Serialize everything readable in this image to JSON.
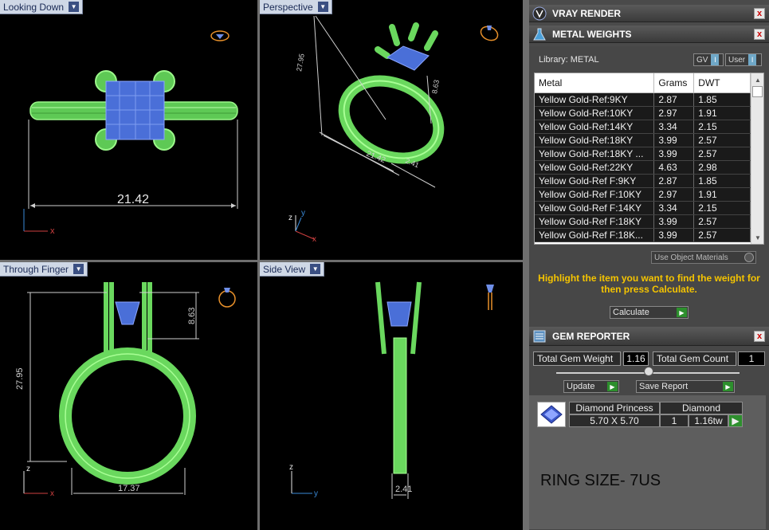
{
  "viewports": {
    "top_left": {
      "label": "Looking Down",
      "dimension": "21.42",
      "axes": [
        "x"
      ]
    },
    "top_right": {
      "label": "Perspective",
      "dimensions": [
        "27.95",
        "8.63",
        "21.42",
        "2.41"
      ],
      "axes": [
        "z",
        "y",
        "x"
      ]
    },
    "bottom_left": {
      "label": "Through Finger",
      "dimensions": [
        "27.95",
        "8.63",
        "17.37"
      ],
      "axes": [
        "z",
        "x"
      ]
    },
    "bottom_right": {
      "label": "Side View",
      "dimension": "2.41",
      "axes": [
        "z",
        "y"
      ]
    }
  },
  "panel": {
    "vray": {
      "title": "VRAY RENDER",
      "close": "x"
    },
    "metal": {
      "title": "METAL WEIGHTS",
      "close": "x",
      "library_label": "Library: METAL",
      "toggle_gv": "GV",
      "toggle_user": "User",
      "toggle_mark": "I",
      "columns": [
        "Metal",
        "Grams",
        "DWT"
      ],
      "rows": [
        [
          "Yellow Gold-Ref:9KY",
          "2.87",
          "1.85"
        ],
        [
          "Yellow Gold-Ref:10KY",
          "2.97",
          "1.91"
        ],
        [
          "Yellow Gold-Ref:14KY",
          "3.34",
          "2.15"
        ],
        [
          "Yellow Gold-Ref:18KY",
          "3.99",
          "2.57"
        ],
        [
          "Yellow Gold-Ref:18KY ...",
          "3.99",
          "2.57"
        ],
        [
          "Yellow Gold-Ref:22KY",
          "4.63",
          "2.98"
        ],
        [
          "Yellow Gold-Ref F:9KY",
          "2.87",
          "1.85"
        ],
        [
          "Yellow Gold-Ref F:10KY",
          "2.97",
          "1.91"
        ],
        [
          "Yellow Gold-Ref F:14KY",
          "3.34",
          "2.15"
        ],
        [
          "Yellow Gold-Ref F:18KY",
          "3.99",
          "2.57"
        ],
        [
          "Yellow Gold-Ref F:18K...",
          "3.99",
          "2.57"
        ]
      ],
      "use_object_materials": "Use Object Materials",
      "hint": "Highlight the item you want to find the weight for then press Calculate.",
      "calculate": "Calculate",
      "go": "▶"
    },
    "gem": {
      "title": "GEM REPORTER",
      "close": "x",
      "total_weight_label": "Total Gem Weight",
      "total_weight_value": "1.16",
      "total_count_label": "Total Gem Count",
      "total_count_value": "1",
      "update": "Update",
      "save_report": "Save Report",
      "go": "▶",
      "gem_name": "Diamond Princess",
      "gem_size": "5.70 X 5.70",
      "gem_type": "Diamond",
      "gem_qty": "1",
      "gem_weight": "1.16tw",
      "ring_size": "RING SIZE- 7US"
    }
  },
  "colors": {
    "wire": "#8ff27a",
    "gem": "#4a6fd8",
    "dim": "#cfcfcf",
    "accent_hint": "#f5c400",
    "axis_x": "#d04040",
    "axis_y": "#3a8ad8",
    "axis_z": "#e6e6e6"
  }
}
